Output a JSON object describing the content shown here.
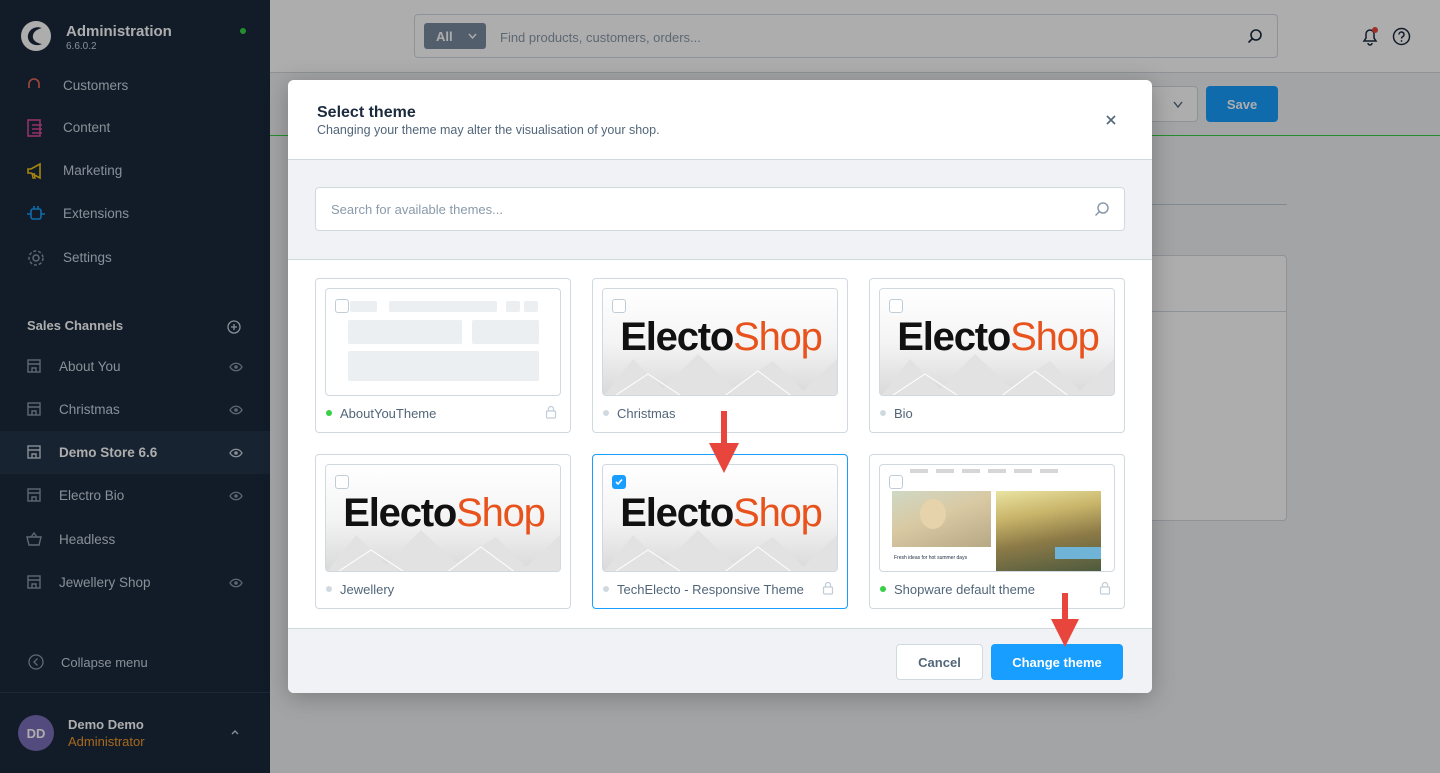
{
  "app": {
    "title": "Administration",
    "version": "6.6.0.2"
  },
  "sidebar": {
    "nav": [
      {
        "label": "Customers",
        "icon": "customers-icon"
      },
      {
        "label": "Content",
        "icon": "content-icon"
      },
      {
        "label": "Marketing",
        "icon": "megaphone-icon"
      },
      {
        "label": "Extensions",
        "icon": "plug-icon"
      },
      {
        "label": "Settings",
        "icon": "gear-icon"
      }
    ],
    "sales_channels_title": "Sales Channels",
    "channels": [
      {
        "label": "About You",
        "icon": "storefront-icon",
        "active": false
      },
      {
        "label": "Christmas",
        "icon": "storefront-icon",
        "active": false
      },
      {
        "label": "Demo Store 6.6",
        "icon": "storefront-icon",
        "active": true
      },
      {
        "label": "Electro Bio",
        "icon": "storefront-icon",
        "active": false
      },
      {
        "label": "Headless",
        "icon": "basket-icon",
        "active": false
      },
      {
        "label": "Jewellery Shop",
        "icon": "storefront-icon",
        "active": false
      }
    ],
    "collapse_label": "Collapse menu",
    "user": {
      "initials": "DD",
      "name": "Demo Demo",
      "role": "Administrator"
    }
  },
  "topbar": {
    "search_type": "All",
    "search_placeholder": "Find products, customers, orders..."
  },
  "page": {
    "save_label": "Save"
  },
  "modal": {
    "title": "Select theme",
    "subtitle": "Changing your theme may alter the visualisation of your shop.",
    "search_placeholder": "Search for available themes...",
    "themes": [
      {
        "name": "AboutYouTheme",
        "preview": "wireframe",
        "status": "active",
        "locked": true,
        "selected": false
      },
      {
        "name": "Christmas",
        "preview": "electoshop",
        "status": "inactive",
        "locked": false,
        "selected": false
      },
      {
        "name": "Bio",
        "preview": "electoshop",
        "status": "inactive",
        "locked": false,
        "selected": false
      },
      {
        "name": "Jewellery",
        "preview": "electoshop",
        "status": "inactive",
        "locked": false,
        "selected": false
      },
      {
        "name": "TechElecto - Responsive Theme",
        "preview": "electoshop",
        "status": "inactive",
        "locked": true,
        "selected": true
      },
      {
        "name": "Shopware default theme",
        "preview": "photo",
        "status": "active",
        "locked": true,
        "selected": false
      }
    ],
    "preview_logo": {
      "part1": "Electo",
      "part2": "Shop"
    },
    "default_theme_caption": "Fresh ideas for hot summer days",
    "cancel_label": "Cancel",
    "confirm_label": "Change theme"
  },
  "colors": {
    "sidebar_bg": "#1b2a3d",
    "primary": "#189eff",
    "status_active": "#37d046",
    "annotation_arrow": "#e8453c",
    "logo_orange": "#e8531d"
  }
}
